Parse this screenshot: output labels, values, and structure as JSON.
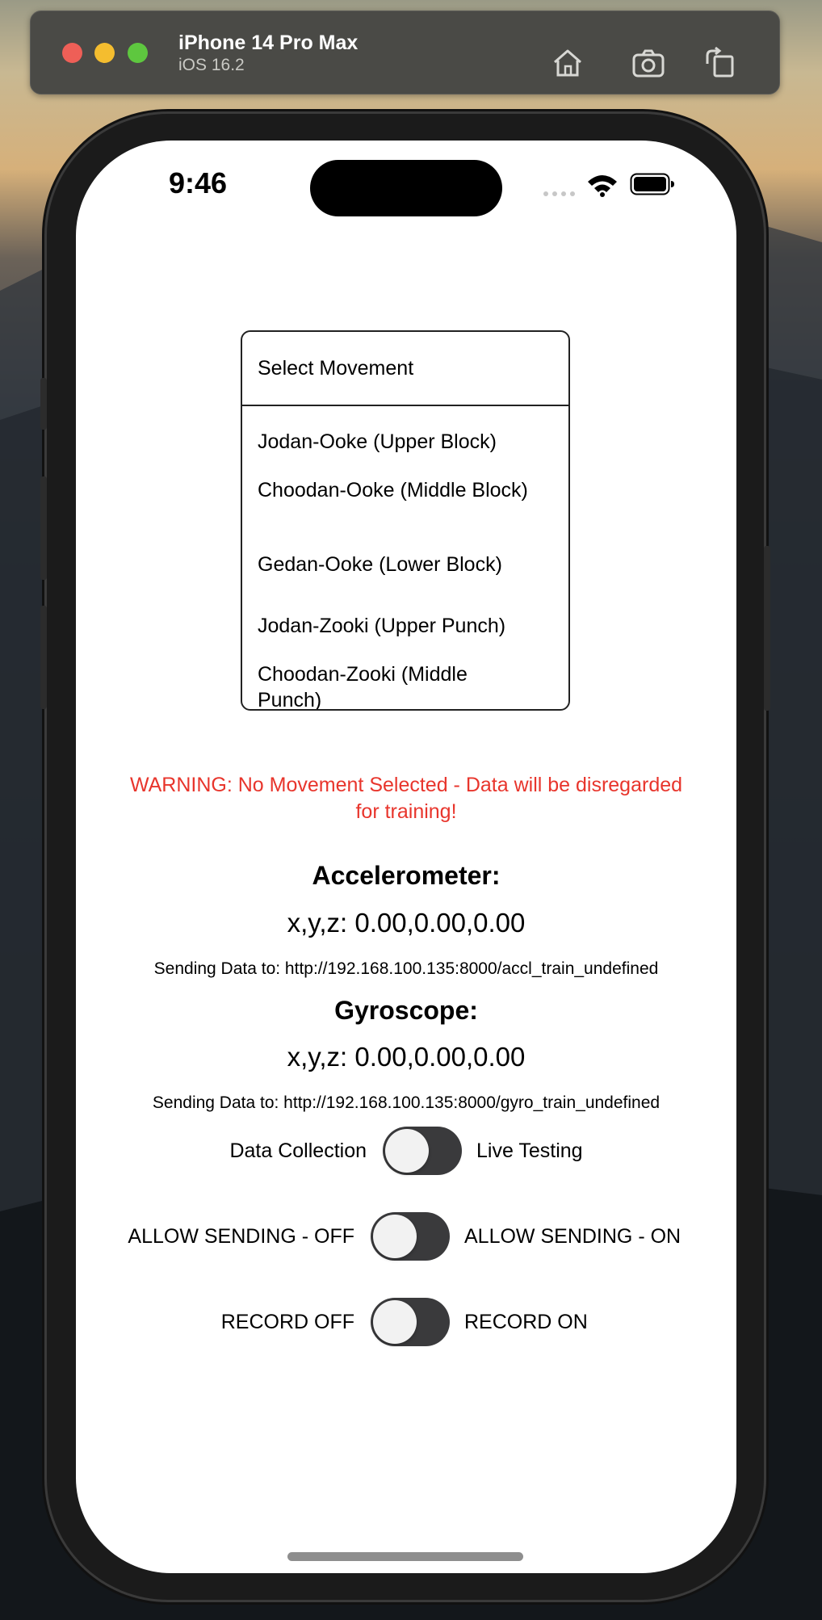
{
  "simulator": {
    "device_name": "iPhone 14 Pro Max",
    "os_version": "iOS 16.2",
    "icons": [
      "home-icon",
      "screenshot-icon",
      "rotate-icon"
    ]
  },
  "status_bar": {
    "time": "9:46",
    "icons": [
      "signal-dots-icon",
      "wifi-icon",
      "battery-icon"
    ]
  },
  "picker": {
    "header": "Select Movement",
    "items": [
      "Jodan-Ooke (Upper Block)",
      "Choodan-Ooke (Middle Block)",
      "Gedan-Ooke (Lower Block)",
      "Jodan-Zooki (Upper Punch)",
      "Choodan-Zooki (Middle Punch)"
    ]
  },
  "warning": "WARNING: No Movement Selected - Data will be disregarded for training!",
  "accelerometer": {
    "title": "Accelerometer:",
    "reading": "x,y,z: 0.00,0.00,0.00",
    "url": "Sending Data to: http://192.168.100.135:8000/accl_train_undefined"
  },
  "gyroscope": {
    "title": "Gyroscope:",
    "reading": "x,y,z: 0.00,0.00,0.00",
    "url": "Sending Data to: http://192.168.100.135:8000/gyro_train_undefined"
  },
  "toggles": {
    "mode": {
      "left": "Data Collection",
      "right": "Live Testing",
      "on": false
    },
    "sending": {
      "left": "ALLOW SENDING - OFF",
      "right": "ALLOW SENDING - ON",
      "on": false
    },
    "record": {
      "left": "RECORD OFF",
      "right": "RECORD ON",
      "on": false
    }
  },
  "colors": {
    "warning": "#e8352c",
    "switch_track": "#3a3a3c",
    "switch_knob": "#f2f2f2"
  }
}
